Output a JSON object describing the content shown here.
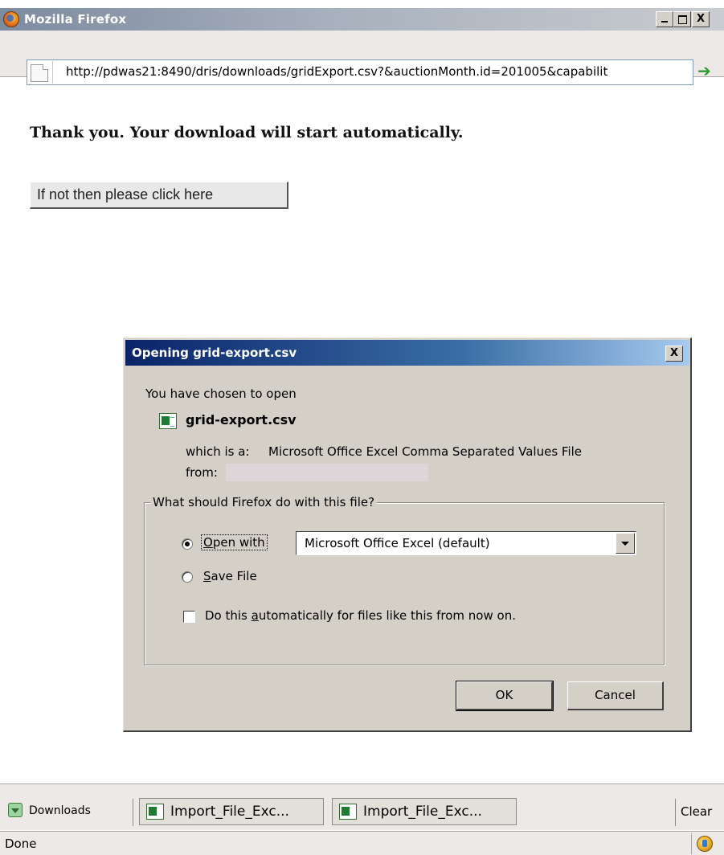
{
  "window": {
    "title": "Mozilla Firefox",
    "minimize_label": "",
    "maximize_label": "",
    "close_label": "X"
  },
  "addressbar": {
    "url": "http://pdwas21:8490/dris/downloads/gridExport.csv?&auctionMonth.id=201005&capabilit",
    "go_icon": "green-arrow-right-icon"
  },
  "page": {
    "heading": "Thank you. Your download will start automatically.",
    "fallback_button": "If not then please click here"
  },
  "dialog": {
    "title": "Opening grid-export.csv",
    "close_label": "X",
    "intro": "You have chosen to open",
    "file_name": "grid-export.csv",
    "file_icon": "excel-file-icon",
    "which_is_label": "which is a:",
    "file_type": "Microsoft Office Excel Comma Separated Values File",
    "from_label": "from:",
    "group_label": "What should Firefox do with this file?",
    "open_with_label": "Open with",
    "open_with_value": "Microsoft Office Excel (default)",
    "save_file_label": "Save File",
    "auto_label_prefix": "Do this ",
    "auto_label_accel": "a",
    "auto_label_suffix": "utomatically for files like this from now on.",
    "open_with_accel": "O",
    "open_with_rest": "pen with",
    "save_accel": "S",
    "save_rest": "ave File",
    "selected_option": "open_with",
    "auto_checked": false,
    "ok_label": "OK",
    "cancel_label": "Cancel"
  },
  "downloads_bar": {
    "downloads_label": "Downloads",
    "items": [
      {
        "label": "Import_File_Exc..."
      },
      {
        "label": "Import_File_Exc..."
      }
    ],
    "clear_label": "Clear"
  },
  "statusbar": {
    "text": "Done"
  }
}
